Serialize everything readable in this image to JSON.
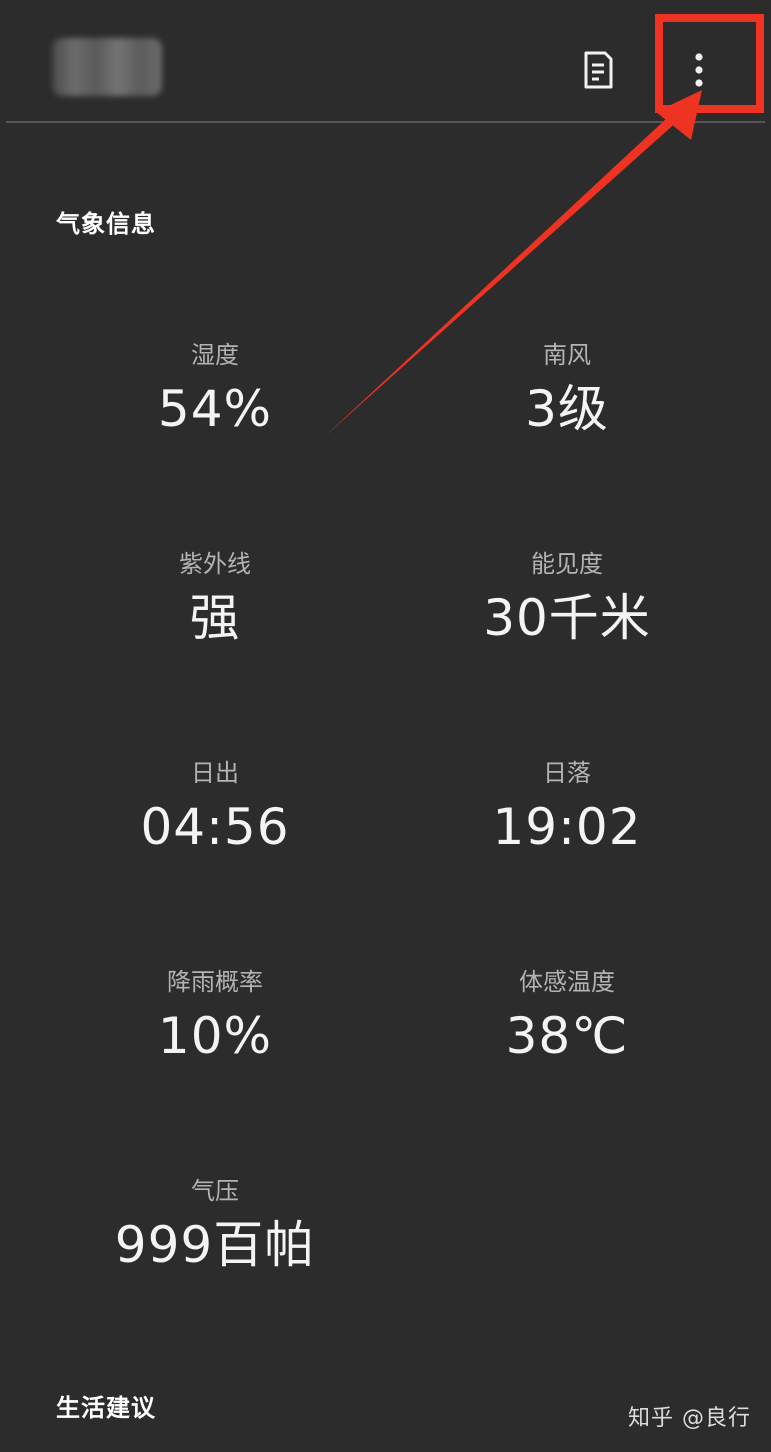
{
  "toolbar": {
    "title_blurred": true,
    "notes_icon": "notes-icon",
    "more_icon": "more-vert-icon"
  },
  "sections": {
    "weather_info": "气象信息",
    "life_advice": "生活建议"
  },
  "metrics": [
    {
      "label": "湿度",
      "value": "54%"
    },
    {
      "label": "南风",
      "value": "3级"
    },
    {
      "label": "紫外线",
      "value": "强"
    },
    {
      "label": "能见度",
      "value": "30千米"
    },
    {
      "label": "日出",
      "value": "04:56"
    },
    {
      "label": "日落",
      "value": "19:02"
    },
    {
      "label": "降雨概率",
      "value": "10%"
    },
    {
      "label": "体感温度",
      "value": "38℃"
    },
    {
      "label": "气压",
      "value": "999百帕"
    }
  ],
  "watermark": "知乎 @良行",
  "annotation": {
    "color": "#ee3322"
  }
}
